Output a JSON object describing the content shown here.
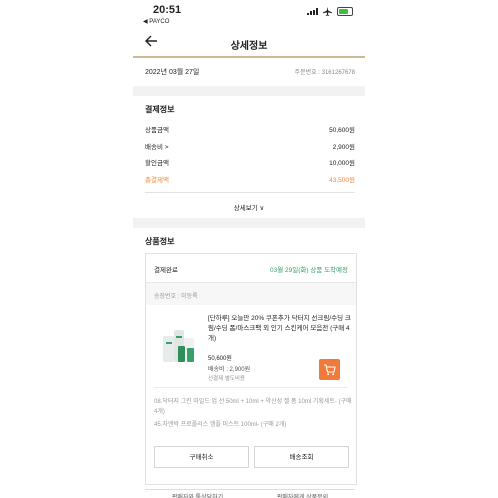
{
  "status": {
    "time": "20:51",
    "back_app": "◀ PAYCO"
  },
  "header": {
    "title": "상세정보"
  },
  "order": {
    "date": "2022년 03월 27일",
    "order_number": "주문번호 : 3161267678"
  },
  "payment": {
    "title": "결제정보",
    "rows": [
      {
        "label": "상품금액",
        "value": "50,600원"
      },
      {
        "label": "배송비 >",
        "value": "2,900원"
      },
      {
        "label": "할인금액",
        "value": "10,000원"
      },
      {
        "label": "총결제액",
        "value": "43,500원"
      }
    ],
    "detail_toggle": "상세보기 ∨"
  },
  "product_section": {
    "title": "상품정보",
    "status": "결제완료",
    "arrival": "03월 29일(화) 상품 도착예정",
    "tracking": "송장번호 : 미등록",
    "name": "[단하루] 오늘만 20% 쿠폰추가 닥터지 선크림/수딩 크림/수딩 폼/마스크팩 외 인기 스킨케어 모음전 (구매 4개)",
    "price": "50,600원",
    "shipping": "배송비 : 2,900원",
    "pay_note": "선결제 별도비용",
    "options": [
      "08.닥터지 그린 마일드 업 선 50ml + 10ml + 약산성 젤 폼 10ml 기획세트- (구매 4개)",
      "45.차앤박 프로폴리스 앰플 미스트 100ml- (구매 2개)"
    ],
    "cancel_button": "구매취소",
    "track_button": "배송조회"
  },
  "bottom": {
    "left": "판매자와 톡상담하기",
    "right": "판매자에게 상품문의"
  },
  "colors": {
    "accent": "#f07a3a",
    "header_line": "#cfb995",
    "arrival": "#3aa06a"
  }
}
